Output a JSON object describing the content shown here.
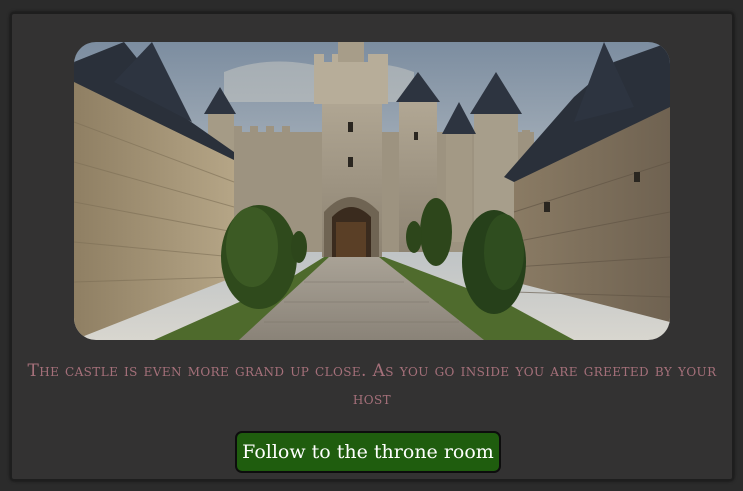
{
  "scene": {
    "image_icon": "castle-courtyard-illustration",
    "narration": "The castle is even more grand up close. As you go inside you are greeted by your host"
  },
  "choices": [
    {
      "label": "Follow to the throne room"
    }
  ],
  "colors": {
    "page_background": "#2b2b2b",
    "panel_background": "#333232",
    "narration_text": "#a5707a",
    "button_background": "#1f5d0e",
    "button_text": "#ffffff"
  }
}
